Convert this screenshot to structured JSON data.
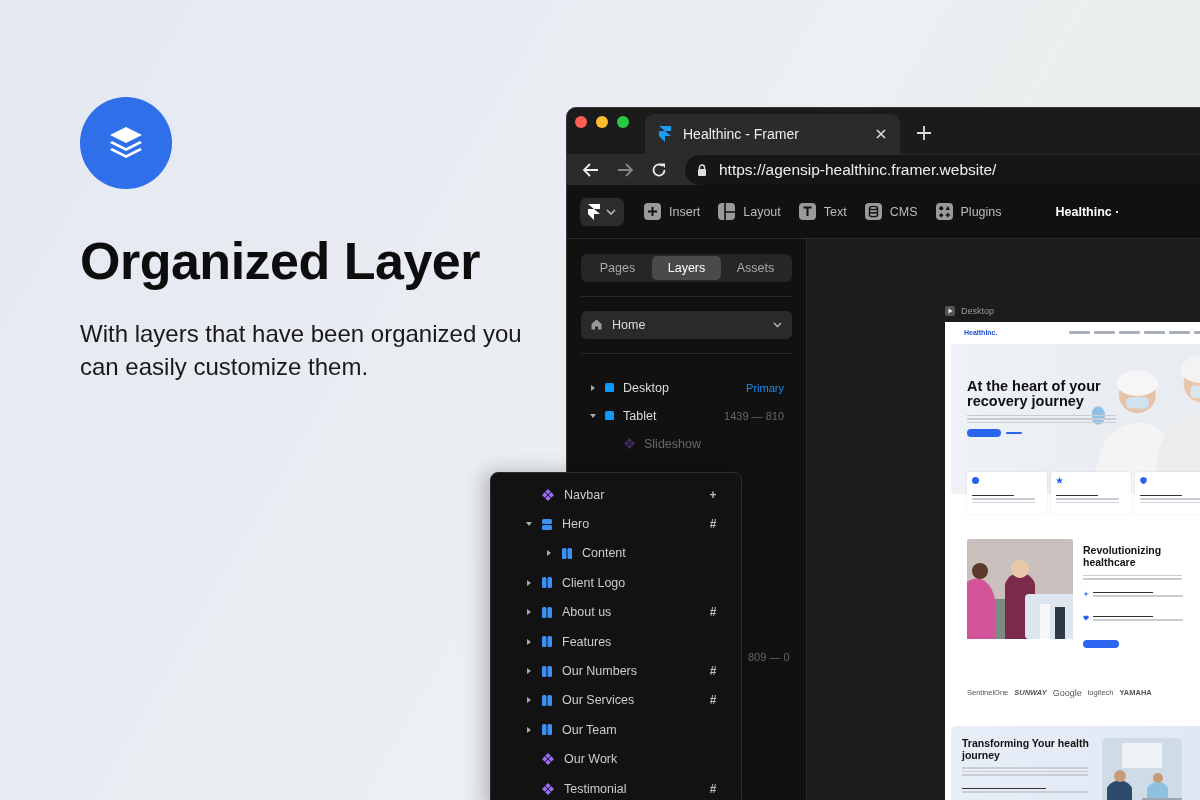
{
  "promo": {
    "title": "Organized Layer",
    "subtitle": "With layers that have been organized you can easily customize them."
  },
  "browser": {
    "tab_title": "Healthinc - Framer",
    "url": "https://agensip-healthinc.framer.website/"
  },
  "toolbar": {
    "items": [
      {
        "label": "Insert",
        "kind": "insert"
      },
      {
        "label": "Layout",
        "kind": "layout"
      },
      {
        "label": "Text",
        "kind": "text"
      },
      {
        "label": "CMS",
        "kind": "cms"
      },
      {
        "label": "Plugins",
        "kind": "plugins"
      }
    ],
    "project": "Healthinc ·"
  },
  "panel_tabs": [
    {
      "label": "Pages",
      "selected": false
    },
    {
      "label": "Layers",
      "selected": true
    },
    {
      "label": "Assets",
      "selected": false
    }
  ],
  "page_select": {
    "value": "Home"
  },
  "layers": [
    {
      "name": "Desktop",
      "kind": "frame",
      "expanded": false,
      "tag": "Primary"
    },
    {
      "name": "Tablet",
      "kind": "frame",
      "expanded": true,
      "meta": "1439 — 810",
      "children": [
        {
          "name": "Slideshow",
          "kind": "component",
          "dimmed": true
        }
      ]
    }
  ],
  "hidden_row_meta": "809 — 0",
  "floating_layers": [
    {
      "name": "Navbar",
      "kind": "component",
      "badge": "+"
    },
    {
      "name": "Hero",
      "kind": "stack",
      "expanded": true,
      "badge": "#",
      "children": [
        {
          "name": "Content",
          "kind": "columns",
          "expanded": false
        }
      ]
    },
    {
      "name": "Client Logo",
      "kind": "columns",
      "expanded": false
    },
    {
      "name": "About us",
      "kind": "columns",
      "expanded": false,
      "badge": "#"
    },
    {
      "name": "Features",
      "kind": "columns",
      "expanded": false
    },
    {
      "name": "Our Numbers",
      "kind": "columns",
      "expanded": false,
      "badge": "#"
    },
    {
      "name": "Our Services",
      "kind": "columns",
      "expanded": false,
      "badge": "#"
    },
    {
      "name": "Our Team",
      "kind": "columns",
      "expanded": false
    },
    {
      "name": "Our Work",
      "kind": "component"
    },
    {
      "name": "Testimonial",
      "kind": "component",
      "badge": "#"
    }
  ],
  "canvas": {
    "frame_label": "Desktop",
    "site": {
      "brand": "HealthInc.",
      "hero_title": "At the heart of your recovery journey",
      "features": [
        {
          "kind": "check"
        },
        {
          "kind": "star"
        },
        {
          "kind": "shield"
        }
      ],
      "about": {
        "title": "Revolutionizing healthcare",
        "points": [
          {
            "kind": "sparkle"
          },
          {
            "kind": "heart"
          }
        ]
      },
      "logos": [
        "SentinelOne",
        "SUNWAY",
        "Google",
        "logitech",
        "YAMAHA"
      ],
      "journey": {
        "title": "Transforming Your health journey"
      }
    }
  }
}
